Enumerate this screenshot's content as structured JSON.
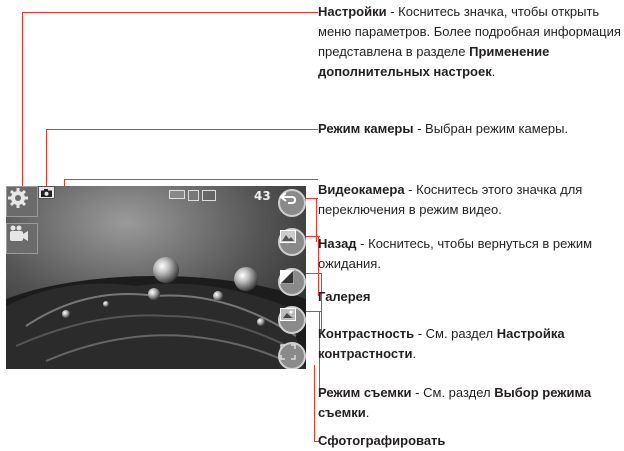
{
  "screen": {
    "shot_count": "43"
  },
  "callouts": {
    "settings": {
      "title": "Настройки",
      "text": " - Коснитесь значка, чтобы открыть меню параметров. Более подробная информация представлена в разделе ",
      "ref": "Применение дополнительных настроек",
      "tail": "."
    },
    "mode": {
      "title": "Режим камеры",
      "text": " - Выбран режим камеры."
    },
    "video": {
      "title": "Видеокамера",
      "text": " - Коснитесь этого значка для переключения в режим видео."
    },
    "back": {
      "title": "Назад",
      "text": " - Коснитесь, чтобы вернуться в режим ожидания."
    },
    "gallery": {
      "title": "Галерея"
    },
    "contrast": {
      "title": "Контрастность",
      "text": " - См. раздел ",
      "ref": "Настройка контрастности",
      "tail": "."
    },
    "shotmode": {
      "title": "Режим съемки",
      "text": " - См. раздел ",
      "ref": "Выбор режима съемки",
      "tail": "."
    },
    "capture": {
      "title": "Сфотографировать"
    }
  },
  "colors": {
    "callout_line": "#e83a2e",
    "text": "#231f20"
  }
}
